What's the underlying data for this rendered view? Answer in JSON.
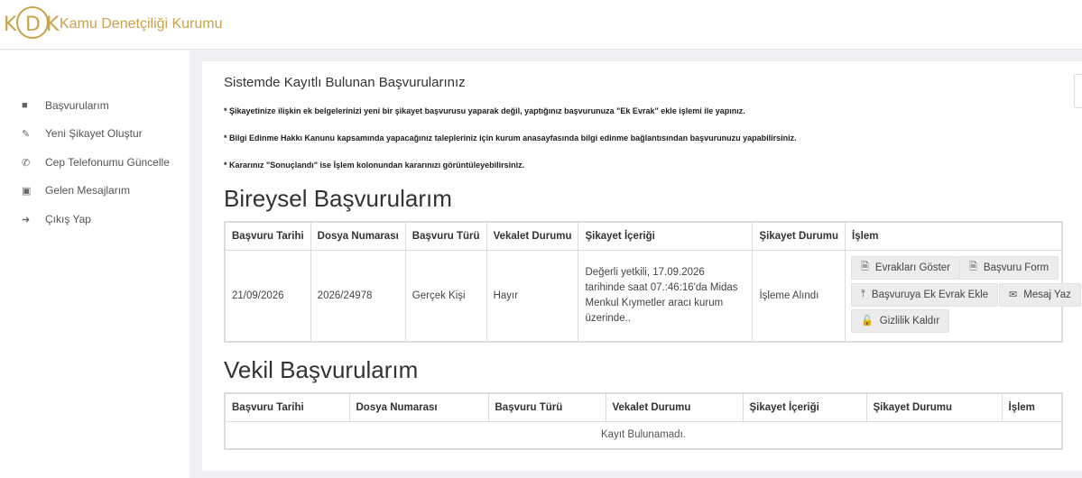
{
  "header": {
    "logo_letters": [
      "K",
      "D",
      "K"
    ],
    "logo_text": "Kamu Denetçiliği Kurumu"
  },
  "sidebar": {
    "items": [
      {
        "label": "Başvurularım",
        "icon": "folder-icon"
      },
      {
        "label": "Yeni Şikayet Oluştur",
        "icon": "pencil-icon"
      },
      {
        "label": "Cep Telefonumu Güncelle",
        "icon": "phone-icon"
      },
      {
        "label": "Gelen Mesajlarım",
        "icon": "folder-open-icon"
      },
      {
        "label": "Çıkış Yap",
        "icon": "logout-icon"
      }
    ]
  },
  "main": {
    "title": "Sistemde Kayıtlı Bulunan Başvurularınız",
    "notes": [
      "* Şikayetinize ilişkin ek belgelerinizi yeni bir şikayet başvurusu yaparak değil, yaptığınız başvurunuza \"Ek Evrak\" ekle işlemi ile yapınız.",
      "* Bilgi Edinme Hakkı Kanunu kapsamında yapacağınız talepleriniz için kurum anasayfasında bilgi edinme bağlantısından başvurunuzu yapabilirsiniz.",
      "* Kararınız \"Sonuçlandı\" ise İşlem kolonundan kararınızı görüntüleyebilirsiniz."
    ],
    "individual": {
      "heading": "Bireysel Başvurularım",
      "columns": [
        "Başvuru Tarihi",
        "Dosya Numarası",
        "Başvuru Türü",
        "Vekalet Durumu",
        "Şikayet İçeriği",
        "Şikayet Durumu",
        "İşlem"
      ],
      "rows": [
        {
          "date": "21/09/2026",
          "file_no": "2026/24978",
          "type": "Gerçek Kişi",
          "proxy": "Hayır",
          "content": "Değerli yetkili, 17.09.2026 tarihinde saat 07.:46:16'da Midas Menkul Kıymetler aracı kurum üzerinde..",
          "status": "İşleme Alındı",
          "actions": {
            "show_docs": "Evrakları Göster",
            "form": "Başvuru Form",
            "add_doc": "Başvuruya Ek Evrak Ekle",
            "message": "Mesaj Yaz",
            "privacy": "Gizlilik Kaldır"
          }
        }
      ]
    },
    "proxy_section": {
      "heading": "Vekil Başvurularım",
      "columns": [
        "Başvuru Tarihi",
        "Dosya Numarası",
        "Başvuru Türü",
        "Vekalet Durumu",
        "Şikayet İçeriği",
        "Şikayet Durumu",
        "İşlem"
      ],
      "empty_text": "Kayıt Bulunamadı."
    }
  },
  "colors": {
    "brand": "#c9a24b",
    "page_bg": "#eef0f3",
    "button_bg": "#ececec"
  }
}
